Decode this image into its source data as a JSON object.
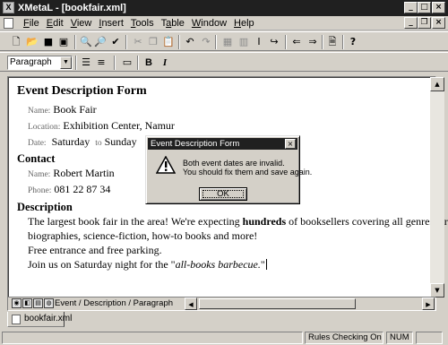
{
  "window": {
    "title": "XMetaL - [bookfair.xml]"
  },
  "menu": [
    "File",
    "Edit",
    "View",
    "Insert",
    "Tools",
    "Table",
    "Window",
    "Help"
  ],
  "menu_underline": [
    "F",
    "E",
    "V",
    "I",
    "T",
    "a",
    "W",
    "H"
  ],
  "toolbar2": {
    "style_value": "Paragraph",
    "bold": "B",
    "italic": "I"
  },
  "document": {
    "heading": "Event Description Form",
    "event": {
      "name_label": "Name:",
      "name_value": "Book Fair",
      "location_label": "Location:",
      "location_value": "Exhibition Center, Namur",
      "date_label": "Date:",
      "date_start": "Saturday",
      "date_to": "to",
      "date_end": "Sunday"
    },
    "contact_heading": "Contact",
    "contact": {
      "name_label": "Name:",
      "name_value": "Robert Martin",
      "phone_label": "Phone:",
      "phone_value": "081 22 87 34"
    },
    "description_heading": "Description",
    "description": {
      "line1_a": "The largest book fair in the area! We're expecting ",
      "line1_bold": "hundreds",
      "line1_b": " of booksellers covering all genres: crime,",
      "line2": "biographies, science-fiction, how-to books and more!",
      "line3": "Free entrance and free parking.",
      "line4_a": "Join us on Saturday night for the \"",
      "line4_italic": "all-books barbecue.",
      "line4_b": "\""
    }
  },
  "element_path": "Event / Description / Paragraph",
  "doc_tab": "bookfair.xml",
  "status": {
    "rules": "Rules Checking On",
    "num": "NUM"
  },
  "dialog": {
    "title": "Event Description Form",
    "line1": "Both event dates are invalid.",
    "line2": "You should fix them and save again.",
    "ok": "OK"
  }
}
